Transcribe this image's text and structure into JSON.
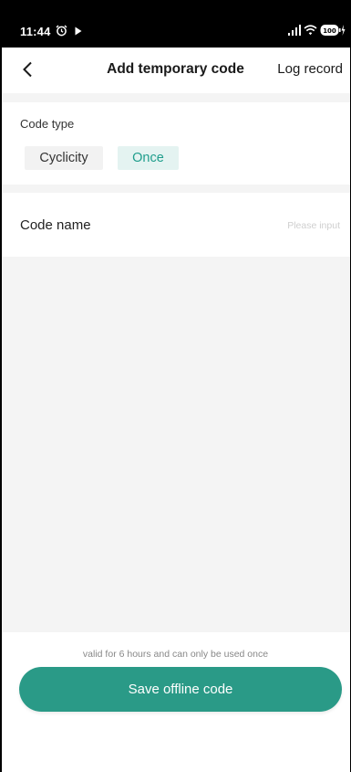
{
  "status_bar": {
    "time": "11:44",
    "icons": [
      "alarm-icon",
      "play-icon",
      "signal-icon",
      "wifi-icon",
      "battery-icon"
    ],
    "battery_level": "100"
  },
  "nav": {
    "back_icon": "chevron-left-icon",
    "title": "Add temporary code",
    "right_action": "Log record"
  },
  "code_type": {
    "label": "Code type",
    "options": [
      "Cyclicity",
      "Once"
    ],
    "selected": "Once"
  },
  "code_name": {
    "label": "Code name",
    "value": "",
    "placeholder": "Please input"
  },
  "footer": {
    "hint": "valid for 6 hours and can only be used once",
    "save_label": "Save offline code"
  },
  "colors": {
    "accent": "#2a9a87",
    "selected_text": "#1f9e8c",
    "selected_bg": "#e4f3f1",
    "page_bg": "#f4f4f4"
  }
}
